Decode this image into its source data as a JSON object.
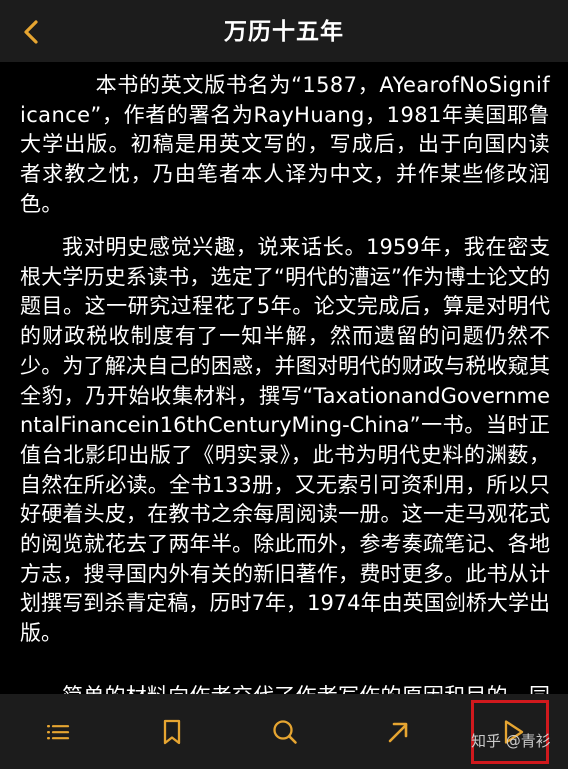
{
  "header": {
    "title": "万历十五年",
    "back_icon": "chevron-left-icon"
  },
  "content": {
    "paragraphs": [
      "本书的英文版书名为“1587，AYearofNoSignificance”，作者的署名为RayHuang，1981年美国耶鲁大学出版。初稿是用英文写的，写成后，出于向国内读者求教之忱，乃由笔者本人译为中文，并作某些修改润色。",
      "我对明史感觉兴趣，说来话长。1959年，我在密支根大学历史系读书，选定了“明代的漕运”作为博士论文的题目。这一研究过程花了5年。论文完成后，算是对明代的财政税收制度有了一知半解，然而遗留的问题仍然不少。为了解决自己的困惑，并图对明代的财政与税收窥其全豹，乃开始收集材料，撰写“TaxationandGovernmentalFinancein16thCenturyMing-China”一书。当时正值台北影印出版了《明实录》，此书为明代史料的渊薮，自然在所必读。全书133册，又无索引可资利用，所以只好硬着头皮，在教书之余每周阅读一册。这一走马观花式的阅览就花去了两年半。除此而外，参考奏疏笔记、各地方志，搜寻国内外有关的新旧著作，费时更多。此书从计划撰写到杀青定稿，历时7年，1974年由英国剑桥大学出版。",
      "简单的材料向作者交代了作者写作的原因和目的，同时也交代了本书"
    ]
  },
  "toolbar": {
    "items": [
      "list-icon",
      "bookmark-icon",
      "search-icon",
      "arrow-up-right-icon",
      "play-icon"
    ]
  },
  "watermark": {
    "text": "知乎 @青衫"
  },
  "colors": {
    "accent": "#e6a531",
    "bar_background": "#1c1c1c",
    "page_background": "#000000",
    "text": "#ffffff",
    "highlight": "#d0191d"
  }
}
